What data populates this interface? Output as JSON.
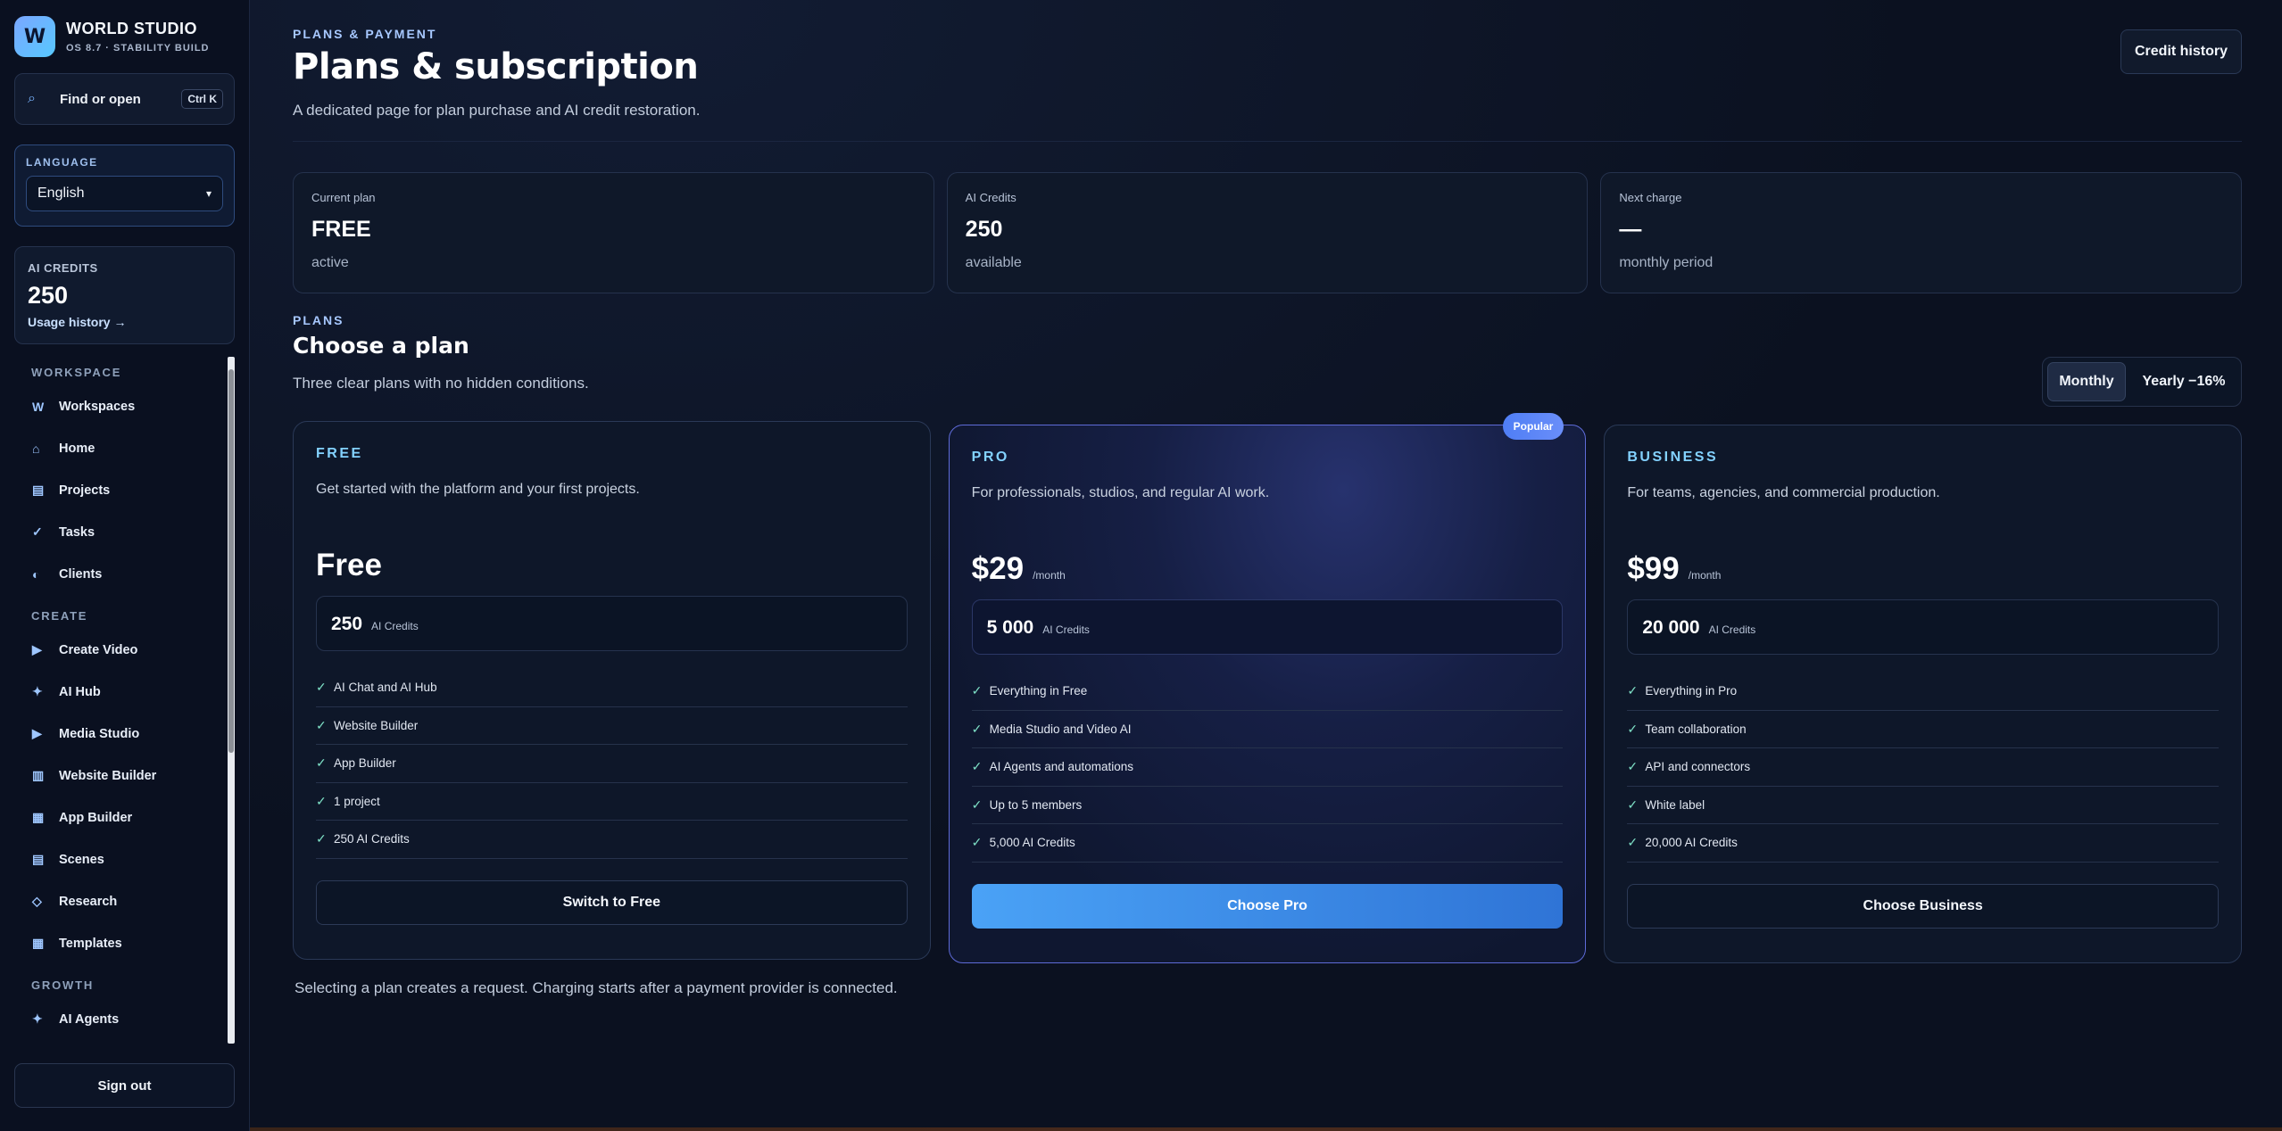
{
  "brand": {
    "logo_letter": "W",
    "title": "WORLD STUDIO",
    "subtitle": "OS 8.7 · STABILITY BUILD"
  },
  "search": {
    "label": "Find or open",
    "shortcut": "Ctrl K",
    "icon": "search-icon"
  },
  "language": {
    "label": "LANGUAGE",
    "selected": "English"
  },
  "credits_widget": {
    "label": "AI CREDITS",
    "value": "250",
    "link": "Usage history →"
  },
  "nav": {
    "sections": [
      {
        "title": "WORKSPACE",
        "items": [
          {
            "icon": "W",
            "label": "Workspaces"
          },
          {
            "icon": "⌂",
            "label": "Home"
          },
          {
            "icon": "▤",
            "label": "Projects"
          },
          {
            "icon": "✓",
            "label": "Tasks"
          },
          {
            "icon": "◐",
            "label": "Clients"
          }
        ]
      },
      {
        "title": "CREATE",
        "items": [
          {
            "icon": "▶",
            "label": "Create Video"
          },
          {
            "icon": "✦",
            "label": "AI Hub"
          },
          {
            "icon": "▶",
            "label": "Media Studio"
          },
          {
            "icon": "▥",
            "label": "Website Builder"
          },
          {
            "icon": "▦",
            "label": "App Builder"
          },
          {
            "icon": "▤",
            "label": "Scenes"
          },
          {
            "icon": "◇",
            "label": "Research"
          },
          {
            "icon": "▦",
            "label": "Templates"
          }
        ]
      },
      {
        "title": "GROWTH",
        "items": [
          {
            "icon": "✦",
            "label": "AI Agents"
          }
        ]
      }
    ],
    "sign_out": "Sign out"
  },
  "header": {
    "eyebrow": "PLANS & PAYMENT",
    "title": "Plans & subscription",
    "description": "A dedicated page for plan purchase and AI credit restoration.",
    "credit_history_button": "Credit history"
  },
  "stats": [
    {
      "label": "Current plan",
      "value": "FREE",
      "sub": "active"
    },
    {
      "label": "AI Credits",
      "value": "250",
      "sub": "available"
    },
    {
      "label": "Next charge",
      "value": "—",
      "sub": "monthly period"
    }
  ],
  "plans_section": {
    "eyebrow": "PLANS",
    "title": "Choose a plan",
    "description": "Three clear plans with no hidden conditions.",
    "billing": {
      "monthly": "Monthly",
      "yearly": "Yearly −16%",
      "selected": "Monthly"
    }
  },
  "plans": [
    {
      "name": "FREE",
      "description": "Get started with the platform and your first projects.",
      "price": "Free",
      "price_unit": "",
      "credits": "250",
      "credits_unit": "AI Credits",
      "features": [
        "AI Chat and AI Hub",
        "Website Builder",
        "App Builder",
        "1 project",
        "250 AI Credits"
      ],
      "button": "Switch to Free"
    },
    {
      "name": "PRO",
      "badge": "Popular",
      "description": "For professionals, studios, and regular AI work.",
      "price": "$29",
      "price_unit": "/month",
      "credits": "5 000",
      "credits_unit": "AI Credits",
      "features": [
        "Everything in Free",
        "Media Studio and Video AI",
        "AI Agents and automations",
        "Up to 5 members",
        "5,000 AI Credits"
      ],
      "button": "Choose Pro"
    },
    {
      "name": "BUSINESS",
      "description": "For teams, agencies, and commercial production.",
      "price": "$99",
      "price_unit": "/month",
      "credits": "20 000",
      "credits_unit": "AI Credits",
      "features": [
        "Everything in Pro",
        "Team collaboration",
        "API and connectors",
        "White label",
        "20,000 AI Credits"
      ],
      "button": "Choose Business"
    }
  ],
  "footer_note": "Selecting a plan creates a request. Charging starts after a payment provider is connected.",
  "colors": {
    "accent": "#4aa2f6",
    "plan_name": "#83d2ff",
    "check": "#7ee0c6",
    "popular_badge": "#4f7ef5",
    "background": "#0b1120"
  }
}
